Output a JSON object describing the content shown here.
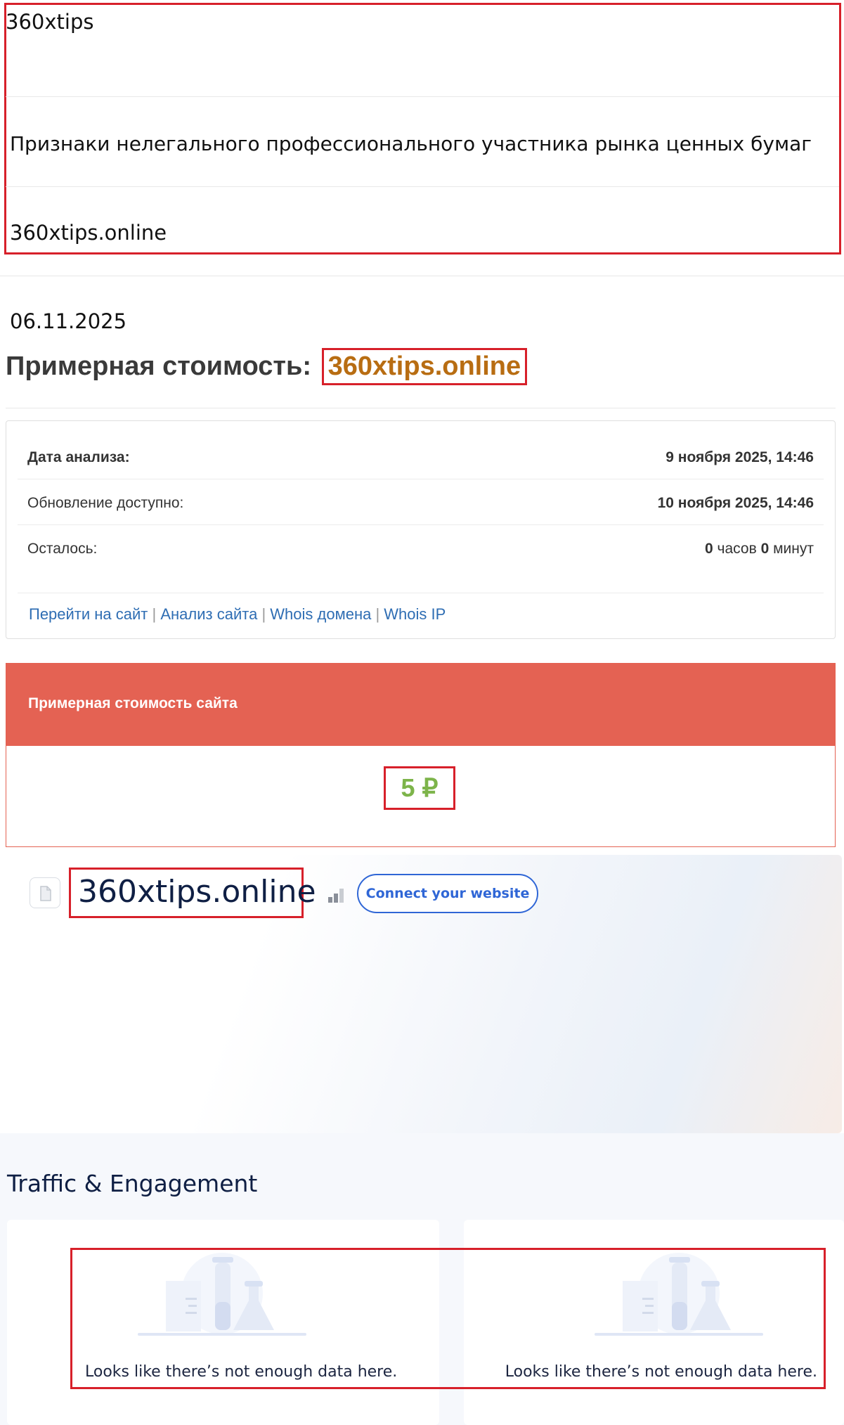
{
  "top": {
    "site": "360xtips",
    "headline": "Признаки нелегального профессионального участника рынка ценных бумаг",
    "domain": "360xtips.online"
  },
  "report": {
    "date": "06.11.2025",
    "title_prefix": "Примерная стоимость: ",
    "title_domain": "360xtips.online"
  },
  "info": {
    "rows": [
      {
        "label": "Дата анализа:",
        "value": "9 ноября 2025, 14:46"
      },
      {
        "label": "Обновление доступно:",
        "value": "10 ноября 2025, 14:46"
      }
    ],
    "remaining_label": "Осталось:",
    "remaining": {
      "hours": "0",
      "hours_unit": " часов ",
      "minutes": "0",
      "minutes_unit": " минут"
    },
    "links": [
      "Перейти на сайт",
      "Анализ сайта",
      "Whois домена",
      "Whois IP"
    ],
    "link_separator": " | "
  },
  "cost": {
    "header": "Примерная стоимость сайта",
    "value": "5 ₽"
  },
  "site_card": {
    "name": "360xtips.online",
    "connect_label": "Connect your website",
    "icons": {
      "favicon": "document-icon",
      "rank": "signal-bars-icon"
    }
  },
  "traffic": {
    "title": "Traffic & Engagement",
    "cards": [
      {
        "message": "Looks like there’s not enough data here.",
        "illustration": "lab-flask-illustration-icon"
      },
      {
        "message": "Looks like there’s not enough data here.",
        "illustration": "lab-flask-illustration-icon"
      }
    ]
  },
  "colors": {
    "highlight_border": "#d7202a",
    "title_domain": "#b86d12",
    "cost_header": "#e46253",
    "price": "#7db44a",
    "link": "#2e6db3",
    "button": "#2f66d6"
  }
}
